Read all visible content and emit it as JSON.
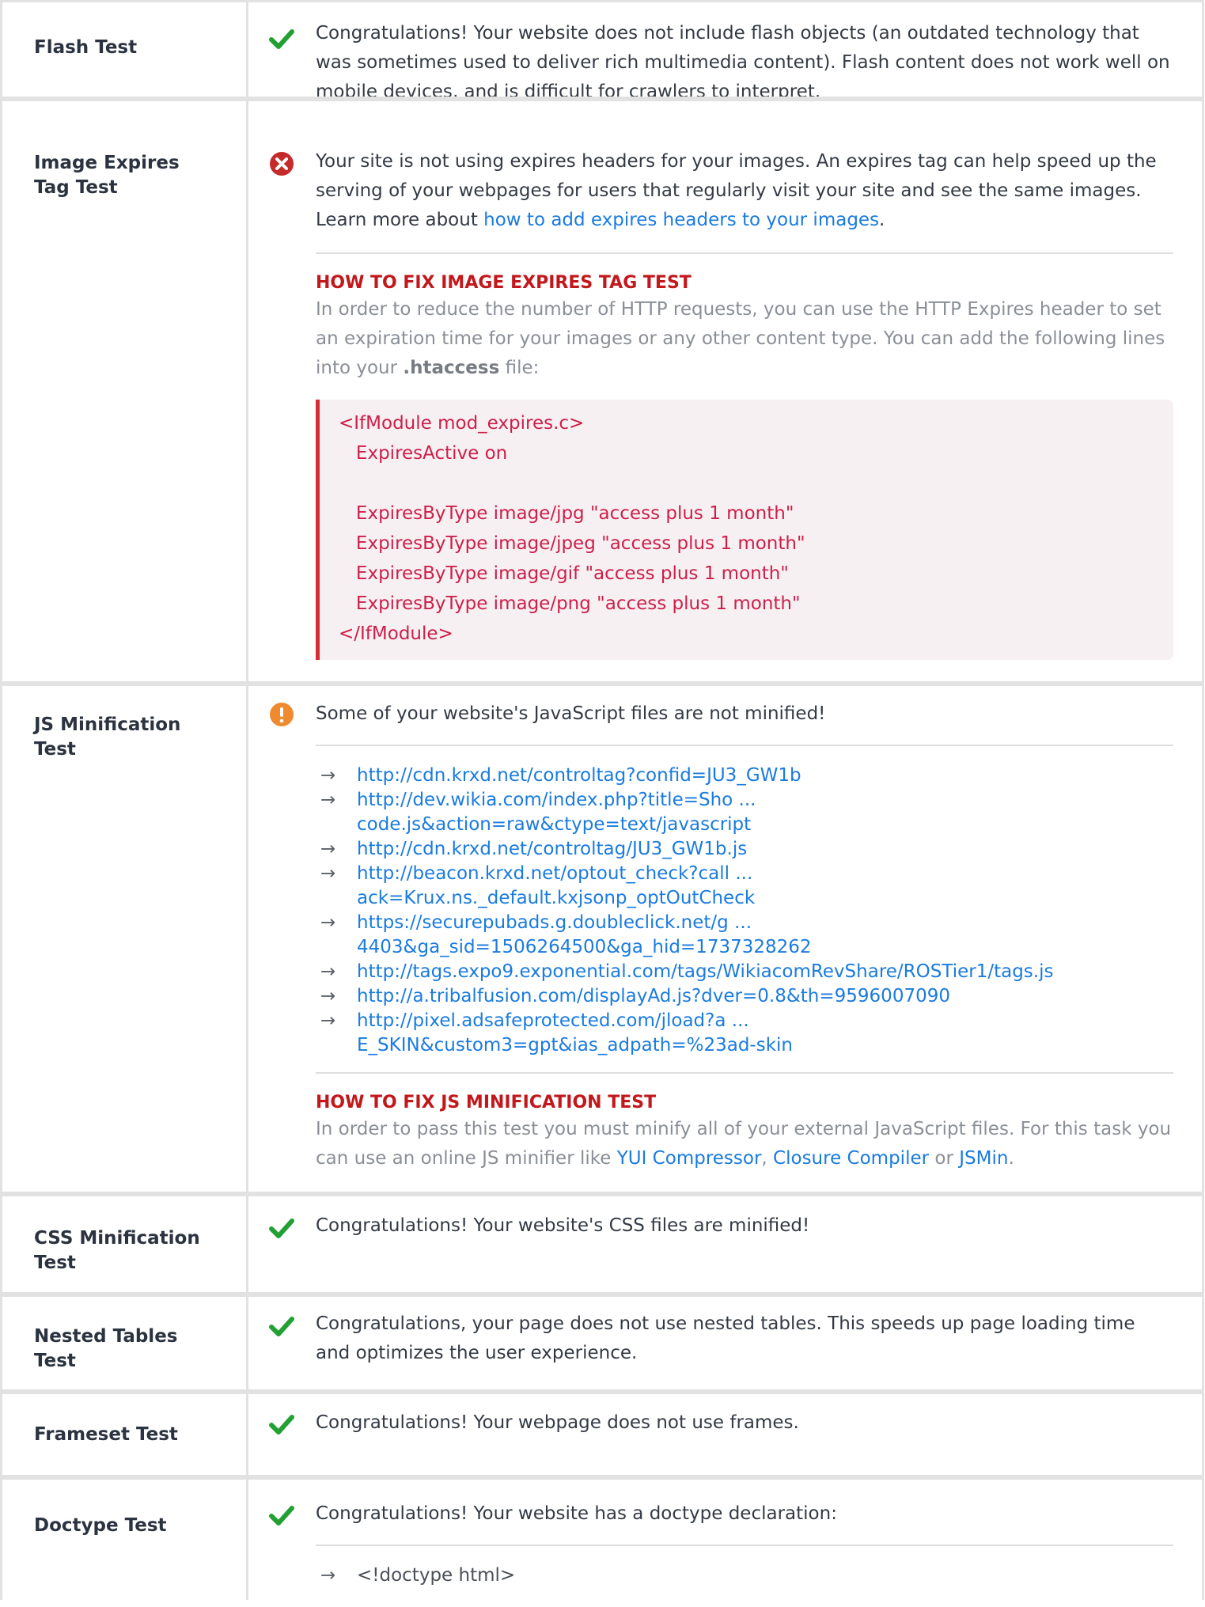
{
  "rows": {
    "flash": {
      "label": "Flash Test",
      "status": "pass",
      "message": "Congratulations! Your website does not include flash objects (an outdated technology that was sometimes used to deliver rich multimedia content). Flash content does not work well on mobile devices, and is difficult for crawlers to interpret."
    },
    "image_expires": {
      "label": "Image Expires Tag Test",
      "status": "fail",
      "message": "Your site is not using expires headers for your images. An expires tag can help speed up the serving of your webpages for users that regularly visit your site and see the same images. Learn more about ",
      "link_text": "how to add expires headers to your images",
      "after_link": ".",
      "howto_title": "HOW TO FIX IMAGE EXPIRES TAG TEST",
      "howto_text_before": "In order to reduce the number of HTTP requests, you can use the HTTP Expires header to set an expiration time for your images or any other content type. You can add the following lines into your ",
      "howto_bold": ".htaccess",
      "howto_text_after": " file:",
      "code": "<IfModule mod_expires.c>\n   ExpiresActive on\n\n   ExpiresByType image/jpg \"access plus 1 month\"\n   ExpiresByType image/jpeg \"access plus 1 month\"\n   ExpiresByType image/gif \"access plus 1 month\"\n   ExpiresByType image/png \"access plus 1 month\"\n</IfModule>"
    },
    "js_min": {
      "label": "JS Minification Test",
      "status": "warning",
      "message": "Some of your website's JavaScript files are not minified!",
      "links": [
        "http://cdn.krxd.net/controltag?confid=JU3_GW1b",
        "http://dev.wikia.com/index.php?title=Sho ... code.js&action=raw&ctype=text/javascript",
        "http://cdn.krxd.net/controltag/JU3_GW1b.js",
        "http://beacon.krxd.net/optout_check?call ... ack=Krux.ns._default.kxjsonp_optOutCheck",
        "https://securepubads.g.doubleclick.net/g ... 4403&ga_sid=1506264500&ga_hid=1737328262",
        "http://tags.expo9.exponential.com/tags/WikiacomRevShare/ROSTier1/tags.js",
        "http://a.tribalfusion.com/displayAd.js?dver=0.8&th=9596007090",
        "http://pixel.adsafeprotected.com/jload?a ... E_SKIN&custom3=gpt&ias_adpath=%23ad-skin"
      ],
      "howto_title": "HOW TO FIX JS MINIFICATION TEST",
      "howto_text": "In order to pass this test you must minify all of your external JavaScript files. For this task you can use an online JS minifier like ",
      "tool1": "YUI Compressor",
      "sep1": ", ",
      "tool2": "Closure Compiler",
      "sep2": " or ",
      "tool3": "JSMin",
      "end": "."
    },
    "css_min": {
      "label": "CSS Minification Test",
      "status": "pass",
      "message": "Congratulations! Your website's CSS files are minified!"
    },
    "nested": {
      "label": "Nested Tables Test",
      "status": "pass",
      "message": "Congratulations, your page does not use nested tables. This speeds up page loading time and optimizes the user experience."
    },
    "frameset": {
      "label": "Frameset Test",
      "status": "pass",
      "message": "Congratulations! Your webpage does not use frames."
    },
    "doctype": {
      "label": "Doctype Test",
      "status": "pass",
      "message": "Congratulations! Your website has a doctype declaration:",
      "item": "<!doctype html>"
    }
  },
  "icons": {
    "pass": "checkmark-icon",
    "fail": "error-circle-icon",
    "warning": "warning-circle-icon",
    "arrow": "arrow-right-icon"
  },
  "colors": {
    "pass": "#23a033",
    "fail": "#c62b2b",
    "warning": "#ef8a2f",
    "link": "#1a7be0",
    "howto": "#c2171b",
    "code": "#cc1f4a"
  }
}
